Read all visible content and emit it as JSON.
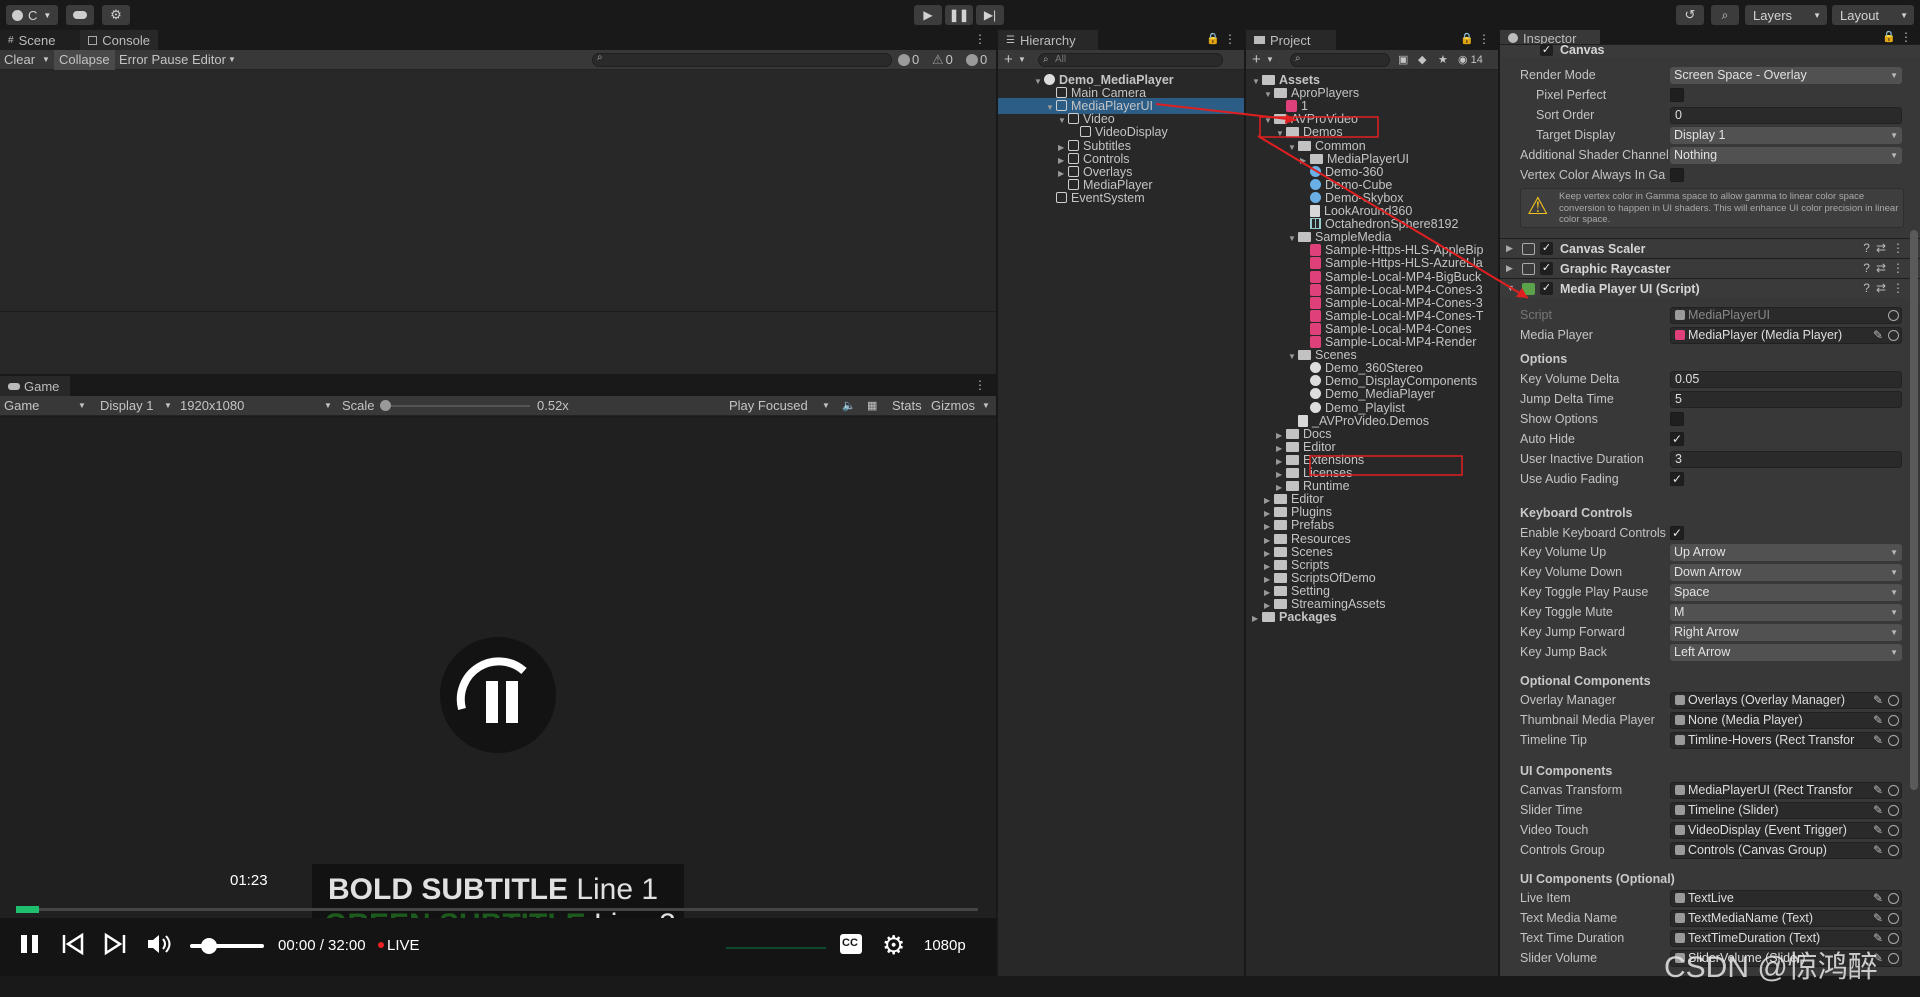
{
  "toolbar": {
    "account": "C",
    "layers": "Layers",
    "layout": "Layout"
  },
  "console": {
    "tabs": [
      "Scene",
      "Console"
    ],
    "clear": "Clear",
    "collapse": "Collapse",
    "error_pause": "Error Pause",
    "editor": "Editor",
    "count_info": "0",
    "count_warn": "0",
    "count_error": "0"
  },
  "game": {
    "tab": "Game",
    "mode": "Game",
    "display": "Display 1",
    "resolution": "1920x1080",
    "scale_label": "Scale",
    "scale_value": "0.52x",
    "play_focused": "Play Focused",
    "stats": "Stats",
    "gizmos": "Gizmos",
    "player": {
      "hover_time": "01:23",
      "sub1_bold": "BOLD SUBTITLE",
      "sub1_rest": " Line 1",
      "sub2_bold": "GREEN SUBTITLE",
      "sub2_rest": " Line 2",
      "time": "00:00 / 32:00",
      "live": "LIVE",
      "quality": "1080p",
      "cc": "CC",
      "progress": 0.024,
      "volume": 0.25
    }
  },
  "hierarchy": {
    "tab": "Hierarchy",
    "search": "All",
    "items": [
      {
        "label": "Demo_MediaPlayer",
        "depth": 0,
        "icon": "unity",
        "arrow": "▼",
        "bold": true
      },
      {
        "label": "Main Camera",
        "depth": 1,
        "icon": "cube",
        "arrow": ""
      },
      {
        "label": "MediaPlayerUI",
        "depth": 1,
        "icon": "cube",
        "arrow": "▼",
        "selected": true
      },
      {
        "label": "Video",
        "depth": 2,
        "icon": "cube",
        "arrow": "▼"
      },
      {
        "label": "VideoDisplay",
        "depth": 3,
        "icon": "cube",
        "arrow": ""
      },
      {
        "label": "Subtitles",
        "depth": 2,
        "icon": "cube",
        "arrow": "▶"
      },
      {
        "label": "Controls",
        "depth": 2,
        "icon": "cube",
        "arrow": "▶"
      },
      {
        "label": "Overlays",
        "depth": 2,
        "icon": "cube",
        "arrow": "▶"
      },
      {
        "label": "MediaPlayer",
        "depth": 2,
        "icon": "cube",
        "arrow": ""
      },
      {
        "label": "EventSystem",
        "depth": 1,
        "icon": "cube",
        "arrow": ""
      }
    ]
  },
  "project": {
    "tab": "Project",
    "hidden_count": "14",
    "items": [
      {
        "label": "Assets",
        "depth": 0,
        "icon": "folder",
        "arrow": "▼",
        "bold": true
      },
      {
        "label": "AproPlayers",
        "depth": 1,
        "icon": "folder",
        "arrow": "▼"
      },
      {
        "label": "1",
        "depth": 2,
        "icon": "media",
        "arrow": ""
      },
      {
        "label": "AVProVideo",
        "depth": 1,
        "icon": "folder",
        "arrow": "▼",
        "boxed": true
      },
      {
        "label": "Demos",
        "depth": 2,
        "icon": "folder",
        "arrow": "▼"
      },
      {
        "label": "Common",
        "depth": 3,
        "icon": "folder",
        "arrow": "▼"
      },
      {
        "label": "MediaPlayerUI",
        "depth": 4,
        "icon": "folder",
        "arrow": "▶"
      },
      {
        "label": "Demo-360",
        "depth": 4,
        "icon": "sphere",
        "arrow": ""
      },
      {
        "label": "Demo-Cube",
        "depth": 4,
        "icon": "sphere",
        "arrow": ""
      },
      {
        "label": "Demo-Skybox",
        "depth": 4,
        "icon": "sphere",
        "arrow": ""
      },
      {
        "label": "LookAround360",
        "depth": 4,
        "icon": "script",
        "arrow": ""
      },
      {
        "label": "OctahedronSphere8192",
        "depth": 4,
        "icon": "grid",
        "arrow": ""
      },
      {
        "label": "SampleMedia",
        "depth": 3,
        "icon": "folder",
        "arrow": "▼"
      },
      {
        "label": "Sample-Https-HLS-AppleBip",
        "depth": 4,
        "icon": "media",
        "arrow": ""
      },
      {
        "label": "Sample-Https-HLS-AzureLla",
        "depth": 4,
        "icon": "media",
        "arrow": ""
      },
      {
        "label": "Sample-Local-MP4-BigBuck",
        "depth": 4,
        "icon": "media",
        "arrow": ""
      },
      {
        "label": "Sample-Local-MP4-Cones-3",
        "depth": 4,
        "icon": "media",
        "arrow": ""
      },
      {
        "label": "Sample-Local-MP4-Cones-3",
        "depth": 4,
        "icon": "media",
        "arrow": ""
      },
      {
        "label": "Sample-Local-MP4-Cones-T",
        "depth": 4,
        "icon": "media",
        "arrow": ""
      },
      {
        "label": "Sample-Local-MP4-Cones",
        "depth": 4,
        "icon": "media",
        "arrow": ""
      },
      {
        "label": "Sample-Local-MP4-Render",
        "depth": 4,
        "icon": "media",
        "arrow": ""
      },
      {
        "label": "Scenes",
        "depth": 3,
        "icon": "folder",
        "arrow": "▼"
      },
      {
        "label": "Demo_360Stereo",
        "depth": 4,
        "icon": "unity",
        "arrow": ""
      },
      {
        "label": "Demo_DisplayComponents",
        "depth": 4,
        "icon": "unity",
        "arrow": ""
      },
      {
        "label": "Demo_MediaPlayer",
        "depth": 4,
        "icon": "unity",
        "arrow": "",
        "boxed": true
      },
      {
        "label": "Demo_Playlist",
        "depth": 4,
        "icon": "unity",
        "arrow": ""
      },
      {
        "label": "_AVProVideo.Demos",
        "depth": 3,
        "icon": "script",
        "arrow": ""
      },
      {
        "label": "Docs",
        "depth": 2,
        "icon": "folder",
        "arrow": "▶"
      },
      {
        "label": "Editor",
        "depth": 2,
        "icon": "folder",
        "arrow": "▶"
      },
      {
        "label": "Extensions",
        "depth": 2,
        "icon": "folder",
        "arrow": "▶"
      },
      {
        "label": "Licenses",
        "depth": 2,
        "icon": "folder",
        "arrow": "▶"
      },
      {
        "label": "Runtime",
        "depth": 2,
        "icon": "folder",
        "arrow": "▶"
      },
      {
        "label": "Editor",
        "depth": 1,
        "icon": "folder",
        "arrow": "▶"
      },
      {
        "label": "Plugins",
        "depth": 1,
        "icon": "folder",
        "arrow": "▶"
      },
      {
        "label": "Prefabs",
        "depth": 1,
        "icon": "folder",
        "arrow": "▶"
      },
      {
        "label": "Resources",
        "depth": 1,
        "icon": "folder",
        "arrow": "▶"
      },
      {
        "label": "Scenes",
        "depth": 1,
        "icon": "folder",
        "arrow": "▶"
      },
      {
        "label": "Scripts",
        "depth": 1,
        "icon": "folder",
        "arrow": "▶"
      },
      {
        "label": "ScriptsOfDemo",
        "depth": 1,
        "icon": "folder",
        "arrow": "▶"
      },
      {
        "label": "Setting",
        "depth": 1,
        "icon": "folder",
        "arrow": "▶"
      },
      {
        "label": "StreamingAssets",
        "depth": 1,
        "icon": "folder",
        "arrow": "▶"
      },
      {
        "label": "Packages",
        "depth": 0,
        "icon": "folder",
        "arrow": "▶",
        "bold": true
      }
    ]
  },
  "inspector": {
    "tab": "Inspector",
    "canvas_title": "Canvas",
    "canvas": {
      "render_mode_label": "Render Mode",
      "render_mode": "Screen Space - Overlay",
      "pixel_perfect_label": "Pixel Perfect",
      "sort_order_label": "Sort Order",
      "sort_order": "0",
      "target_display_label": "Target Display",
      "target_display": "Display 1",
      "shader_channel_label": "Additional Shader Channel",
      "shader_channel": "Nothing",
      "vertex_label": "Vertex Color Always In Gar",
      "warning": "Keep vertex color in Gamma space to allow gamma to linear color space conversion to happen in UI shaders. This will enhance UI color precision in linear color space."
    },
    "canvas_scaler": "Canvas Scaler",
    "graphic_raycaster": "Graphic Raycaster",
    "mpui_title": "Media Player UI (Script)",
    "script_label": "Script",
    "script_value": "MediaPlayerUI",
    "media_player_label": "Media Player",
    "media_player_value": "MediaPlayer (Media Player)",
    "options_header": "Options",
    "key_volume_delta_label": "Key Volume Delta",
    "key_volume_delta": "0.05",
    "jump_delta_label": "Jump Delta Time",
    "jump_delta": "5",
    "show_options_label": "Show Options",
    "auto_hide_label": "Auto Hide",
    "inactive_label": "User Inactive Duration",
    "inactive": "3",
    "audio_fading_label": "Use Audio Fading",
    "keyboard_header": "Keyboard Controls",
    "enable_kb_label": "Enable Keyboard Controls",
    "keys": [
      {
        "label": "Key Volume Up",
        "value": "Up Arrow"
      },
      {
        "label": "Key Volume Down",
        "value": "Down Arrow"
      },
      {
        "label": "Key Toggle Play Pause",
        "value": "Space"
      },
      {
        "label": "Key Toggle Mute",
        "value": "M"
      },
      {
        "label": "Key Jump Forward",
        "value": "Right Arrow"
      },
      {
        "label": "Key Jump Back",
        "value": "Left Arrow"
      }
    ],
    "optional_header": "Optional Components",
    "optional": [
      {
        "label": "Overlay Manager",
        "value": "Overlays (Overlay Manager)"
      },
      {
        "label": "Thumbnail Media Player",
        "value": "None (Media Player)"
      },
      {
        "label": "Timeline Tip",
        "value": "Timline-Hovers (Rect Transfor"
      }
    ],
    "ui_header": "UI Components",
    "ui": [
      {
        "label": "Canvas Transform",
        "value": "MediaPlayerUI (Rect Transfor"
      },
      {
        "label": "Slider Time",
        "value": "Timeline (Slider)"
      },
      {
        "label": "Video Touch",
        "value": "VideoDisplay (Event Trigger)"
      },
      {
        "label": "Controls Group",
        "value": "Controls (Canvas Group)"
      }
    ],
    "ui_opt_header": "UI Components (Optional)",
    "ui_opt": [
      {
        "label": "Live Item",
        "value": "TextLive"
      },
      {
        "label": "Text Media Name",
        "value": "TextMediaName (Text)"
      },
      {
        "label": "Text Time Duration",
        "value": "TextTimeDuration (Text)"
      },
      {
        "label": "Slider Volume",
        "value": "SliderVolume (Slider)"
      }
    ]
  },
  "watermark": "CSDN @惊鸿醉"
}
